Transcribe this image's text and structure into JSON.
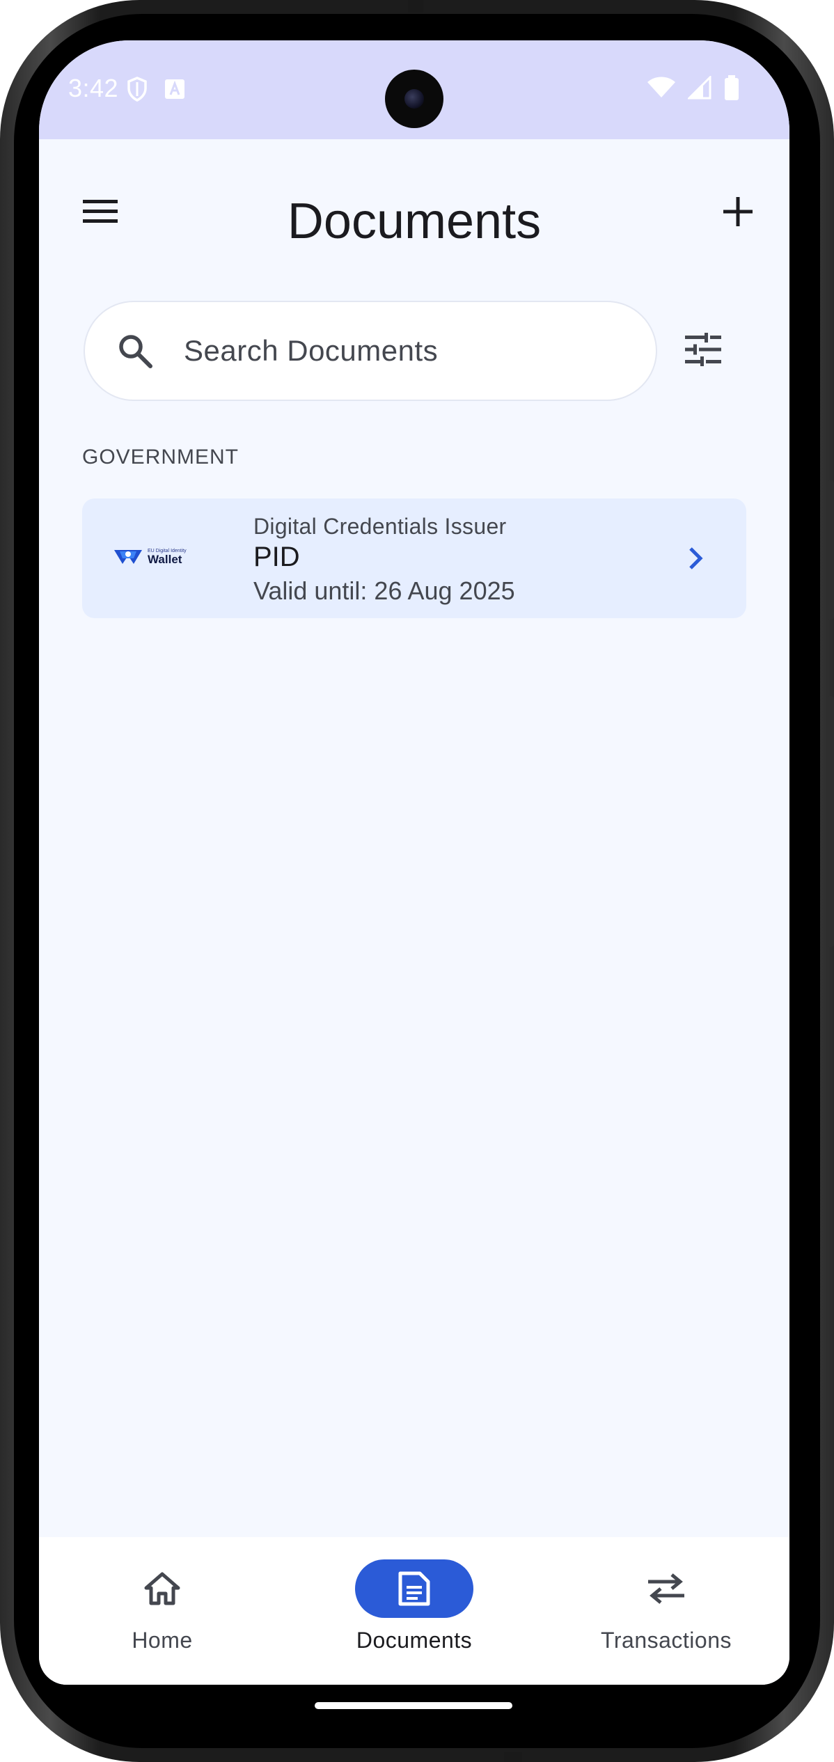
{
  "status_bar": {
    "time": "3:42",
    "left_icons": [
      "shield-icon",
      "text-a-icon"
    ],
    "right_icons": [
      "wifi-icon",
      "signal-icon",
      "battery-icon"
    ]
  },
  "top_bar": {
    "title": "Documents",
    "menu_icon": "menu-icon",
    "add_icon": "plus-icon"
  },
  "search": {
    "placeholder": "Search Documents",
    "value": "",
    "filter_icon": "tune-icon"
  },
  "sections": [
    {
      "label": "GOVERNMENT",
      "documents": [
        {
          "issuer": "Digital Credentials Issuer",
          "name": "PID",
          "validity": "Valid until: 26 Aug 2025",
          "logo_small": "EU Digital Identity",
          "logo_big": "Wallet"
        }
      ]
    }
  ],
  "bottom_nav": {
    "items": [
      {
        "label": "Home",
        "icon": "home-icon",
        "active": false
      },
      {
        "label": "Documents",
        "icon": "document-icon",
        "active": true
      },
      {
        "label": "Transactions",
        "icon": "swap-icon",
        "active": false
      }
    ]
  },
  "colors": {
    "accent": "#2b5bd7",
    "status_bar_bg": "#d8d9fb",
    "screen_bg": "#f5f8ff",
    "card_bg": "#e6eeff"
  }
}
